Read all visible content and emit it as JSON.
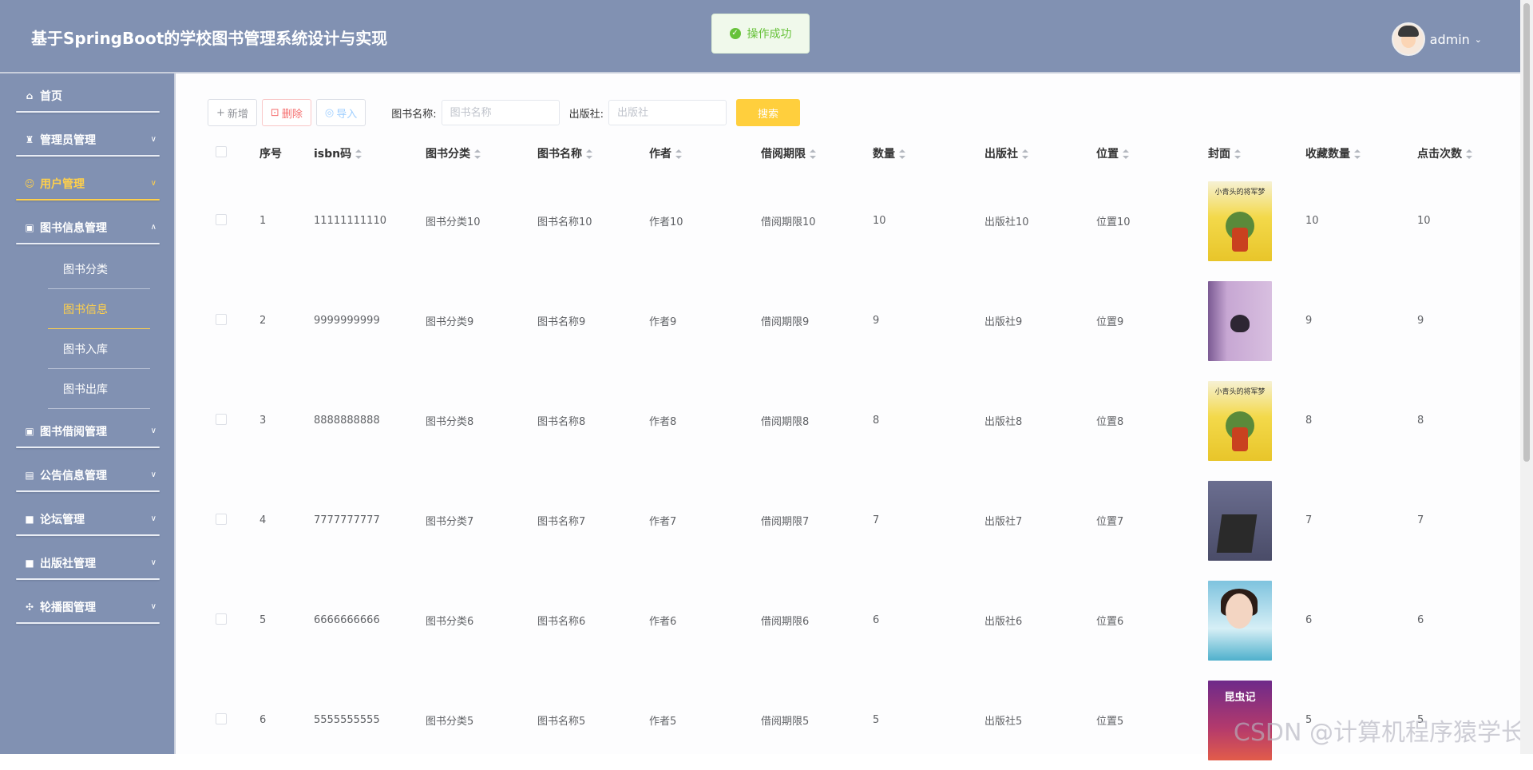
{
  "header": {
    "title": "基于SpringBoot的学校图书管理系统设计与实现",
    "toast": "操作成功",
    "user": "admin"
  },
  "sidebar": {
    "items": [
      {
        "label": "首页",
        "icon": "home-icon"
      },
      {
        "label": "管理员管理",
        "icon": "admin-icon"
      },
      {
        "label": "用户管理",
        "icon": "user-icon",
        "active": true
      },
      {
        "label": "图书信息管理",
        "icon": "book-icon",
        "expanded": true
      },
      {
        "label": "图书借阅管理",
        "icon": "book-icon"
      },
      {
        "label": "公告信息管理",
        "icon": "notice-icon"
      },
      {
        "label": "论坛管理",
        "icon": "forum-icon"
      },
      {
        "label": "出版社管理",
        "icon": "publisher-icon"
      },
      {
        "label": "轮播图管理",
        "icon": "carousel-icon"
      }
    ],
    "sub_items": [
      "图书分类",
      "图书信息",
      "图书入库",
      "图书出库"
    ]
  },
  "toolbar": {
    "add": "新增",
    "delete": "删除",
    "import": "导入",
    "name_label": "图书名称:",
    "name_placeholder": "图书名称",
    "publisher_label": "出版社:",
    "publisher_placeholder": "出版社",
    "search": "搜索"
  },
  "table": {
    "columns": [
      "序号",
      "isbn码",
      "图书分类",
      "图书名称",
      "作者",
      "借阅期限",
      "数量",
      "出版社",
      "位置",
      "封面",
      "收藏数量",
      "点击次数"
    ],
    "rows": [
      {
        "no": "1",
        "isbn": "11111111110",
        "category": "图书分类10",
        "name": "图书名称10",
        "author": "作者10",
        "period": "借阅期限10",
        "qty": "10",
        "publisher": "出版社10",
        "location": "位置10",
        "cover": "小青头的将军梦",
        "fav": "10",
        "clicks": "10"
      },
      {
        "no": "2",
        "isbn": "9999999999",
        "category": "图书分类9",
        "name": "图书名称9",
        "author": "作者9",
        "period": "借阅期限9",
        "qty": "9",
        "publisher": "出版社9",
        "location": "位置9",
        "cover": "",
        "fav": "9",
        "clicks": "9"
      },
      {
        "no": "3",
        "isbn": "8888888888",
        "category": "图书分类8",
        "name": "图书名称8",
        "author": "作者8",
        "period": "借阅期限8",
        "qty": "8",
        "publisher": "出版社8",
        "location": "位置8",
        "cover": "小青头的将军梦",
        "fav": "8",
        "clicks": "8"
      },
      {
        "no": "4",
        "isbn": "7777777777",
        "category": "图书分类7",
        "name": "图书名称7",
        "author": "作者7",
        "period": "借阅期限7",
        "qty": "7",
        "publisher": "出版社7",
        "location": "位置7",
        "cover": "",
        "fav": "7",
        "clicks": "7"
      },
      {
        "no": "5",
        "isbn": "6666666666",
        "category": "图书分类6",
        "name": "图书名称6",
        "author": "作者6",
        "period": "借阅期限6",
        "qty": "6",
        "publisher": "出版社6",
        "location": "位置6",
        "cover": "",
        "fav": "6",
        "clicks": "6"
      },
      {
        "no": "6",
        "isbn": "5555555555",
        "category": "图书分类5",
        "name": "图书名称5",
        "author": "作者5",
        "period": "借阅期限5",
        "qty": "5",
        "publisher": "出版社5",
        "location": "位置5",
        "cover": "昆虫记",
        "fav": "5",
        "clicks": "5"
      }
    ]
  },
  "watermark": "CSDN @计算机程序猿学长"
}
